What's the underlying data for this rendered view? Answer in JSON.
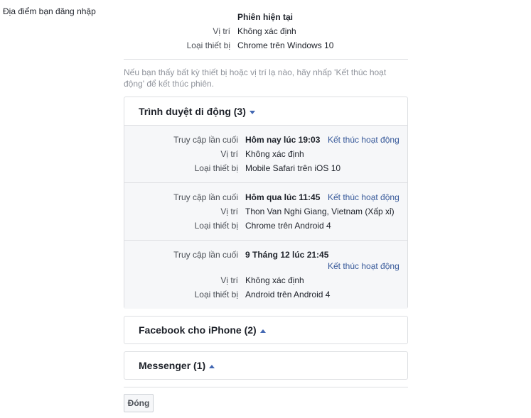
{
  "section_title": "Địa điểm bạn đăng nhập",
  "current_session": {
    "heading": "Phiên hiện tại",
    "location_label": "Vị trí",
    "location_value": "Không xác định",
    "device_label": "Loại thiết bị",
    "device_value": "Chrome trên Windows 10"
  },
  "hint": "Nếu bạn thấy bất kỳ thiết bị hoặc vị trí lạ nào, hãy nhấp 'Kết thúc hoạt động' để kết thúc phiên.",
  "groups": [
    {
      "title": "Trình duyệt di động (3)",
      "expanded": true,
      "sessions": [
        {
          "last_access_label": "Truy cập lần cuối",
          "last_access_value": "Hôm nay lúc 19:03",
          "end_label": "Kết thúc hoạt động",
          "location_label": "Vị trí",
          "location_value": "Không xác định",
          "device_label": "Loại thiết bị",
          "device_value": "Mobile Safari trên iOS 10"
        },
        {
          "last_access_label": "Truy cập lần cuối",
          "last_access_value": "Hôm qua lúc 11:45",
          "end_label": "Kết thúc hoạt động",
          "location_label": "Vị trí",
          "location_value": "Thon Van Nghi Giang, Vietnam (Xấp xỉ)",
          "device_label": "Loại thiết bị",
          "device_value": "Chrome trên Android 4"
        },
        {
          "last_access_label": "Truy cập lần cuối",
          "last_access_value": "9 Tháng 12 lúc 21:45",
          "end_label": "Kết thúc hoạt động",
          "location_label": "Vị trí",
          "location_value": "Không xác định",
          "device_label": "Loại thiết bị",
          "device_value": "Android trên Android 4"
        }
      ]
    },
    {
      "title": "Facebook cho iPhone (2)",
      "expanded": false
    },
    {
      "title": "Messenger (1)",
      "expanded": false
    }
  ],
  "close_label": "Đóng",
  "colors": {
    "link": "#365899",
    "caret": "#4267b2",
    "session_bg": "#f6f7f9",
    "border": "#dddfe2"
  }
}
